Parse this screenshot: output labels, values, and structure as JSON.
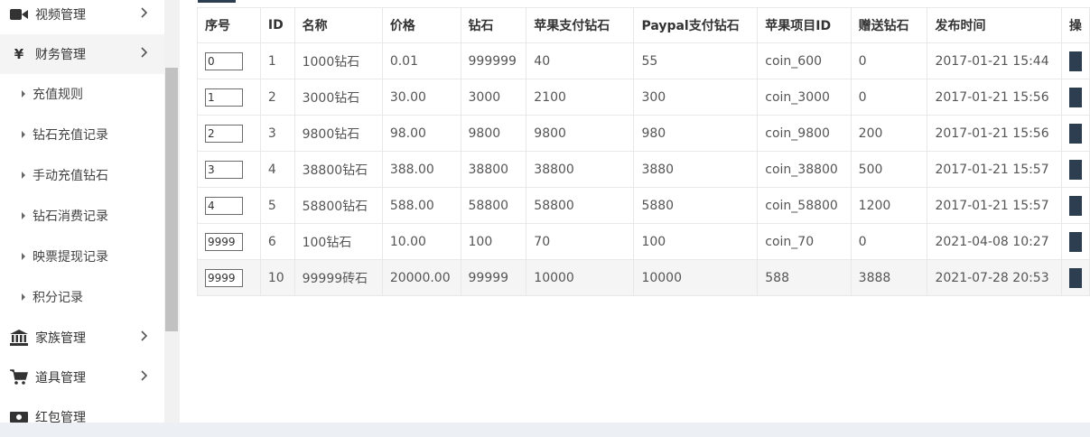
{
  "sidebar": {
    "items": [
      {
        "label": "视频管理",
        "icon": "video-camera-icon"
      },
      {
        "label": "财务管理",
        "icon": "yen-icon",
        "symbol": "¥"
      },
      {
        "label": "家族管理",
        "icon": "bank-icon"
      },
      {
        "label": "道具管理",
        "icon": "cart-icon"
      },
      {
        "label": "红包管理",
        "icon": "money-icon"
      }
    ],
    "sub_items": [
      "充值规则",
      "钻石充值记录",
      "手动充值钻石",
      "钻石消费记录",
      "映票提现记录",
      "积分记录"
    ]
  },
  "table": {
    "headers": [
      "序号",
      "ID",
      "名称",
      "价格",
      "钻石",
      "苹果支付钻石",
      "Paypal支付钻石",
      "苹果项目ID",
      "赠送钻石",
      "发布时间",
      "操"
    ],
    "rows": [
      {
        "order": "0",
        "id": "1",
        "name": "1000钻石",
        "price": "0.01",
        "diamonds": "999999",
        "apple": "40",
        "paypal": "55",
        "apple_id": "coin_600",
        "gift": "0",
        "time": "2017-01-21 15:44"
      },
      {
        "order": "1",
        "id": "2",
        "name": "3000钻石",
        "price": "30.00",
        "diamonds": "3000",
        "apple": "2100",
        "paypal": "300",
        "apple_id": "coin_3000",
        "gift": "0",
        "time": "2017-01-21 15:56"
      },
      {
        "order": "2",
        "id": "3",
        "name": "9800钻石",
        "price": "98.00",
        "diamonds": "9800",
        "apple": "9800",
        "paypal": "980",
        "apple_id": "coin_9800",
        "gift": "200",
        "time": "2017-01-21 15:56"
      },
      {
        "order": "3",
        "id": "4",
        "name": "38800钻石",
        "price": "388.00",
        "diamonds": "38800",
        "apple": "38800",
        "paypal": "3880",
        "apple_id": "coin_38800",
        "gift": "500",
        "time": "2017-01-21 15:57"
      },
      {
        "order": "4",
        "id": "5",
        "name": "58800钻石",
        "price": "588.00",
        "diamonds": "58800",
        "apple": "58800",
        "paypal": "5880",
        "apple_id": "coin_58800",
        "gift": "1200",
        "time": "2017-01-21 15:57"
      },
      {
        "order": "9999",
        "id": "6",
        "name": "100钻石",
        "price": "10.00",
        "diamonds": "100",
        "apple": "70",
        "paypal": "100",
        "apple_id": "coin_70",
        "gift": "0",
        "time": "2021-04-08 10:27"
      },
      {
        "order": "9999",
        "id": "10",
        "name": "99999砖石",
        "price": "20000.00",
        "diamonds": "99999",
        "apple": "10000",
        "paypal": "10000",
        "apple_id": "588",
        "gift": "3888",
        "time": "2021-07-28 20:53"
      }
    ]
  },
  "colors": {
    "accent": "#2c3e50",
    "sidebar_bg": "#ffffff",
    "page_bg": "#ecf0f5"
  }
}
